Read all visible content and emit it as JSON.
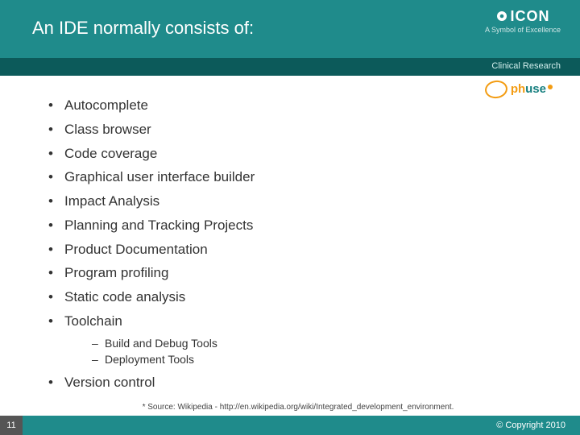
{
  "header": {
    "title": "An IDE normally consists of:",
    "brand": "ICON",
    "brand_tag": "A Symbol of Excellence",
    "subbar": "Clinical Research"
  },
  "phuse": {
    "p": "ph",
    "h": "use"
  },
  "bullets": [
    {
      "label": "Autocomplete"
    },
    {
      "label": "Class browser"
    },
    {
      "label": "Code coverage"
    },
    {
      "label": "Graphical user interface builder"
    },
    {
      "label": "Impact Analysis"
    },
    {
      "label": "Planning and Tracking Projects"
    },
    {
      "label": "Product Documentation"
    },
    {
      "label": "Program profiling"
    },
    {
      "label": "Static code analysis"
    },
    {
      "label": "Toolchain",
      "sub": [
        "Build and Debug Tools",
        "Deployment Tools"
      ]
    },
    {
      "label": "Version control"
    }
  ],
  "source_line": "* Source: Wikipedia - http://en.wikipedia.org/wiki/Integrated_development_environment.",
  "footer": {
    "page": "11",
    "mid": "",
    "copyright": "© Copyright 2010"
  }
}
